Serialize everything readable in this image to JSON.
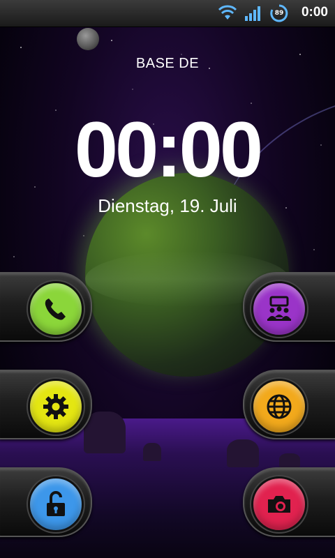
{
  "status_bar": {
    "time": "0:00",
    "battery_level": "89",
    "icons": [
      "wifi-icon",
      "signal-icon",
      "battery-icon"
    ]
  },
  "lockscreen": {
    "carrier": "BASE DE",
    "clock": "00:00",
    "date": "Dienstag, 19. Juli"
  },
  "shortcuts": [
    {
      "icon": "phone-icon",
      "color": "#8bd63a",
      "side": "left"
    },
    {
      "icon": "conference-icon",
      "color": "#9a34c8",
      "side": "right"
    },
    {
      "icon": "gear-icon",
      "color": "#e4e612",
      "side": "left"
    },
    {
      "icon": "globe-icon",
      "color": "#f2a91c",
      "side": "right"
    },
    {
      "icon": "unlock-icon",
      "color": "#3d97ea",
      "side": "left"
    },
    {
      "icon": "camera-icon",
      "color": "#e1224f",
      "side": "right"
    }
  ]
}
